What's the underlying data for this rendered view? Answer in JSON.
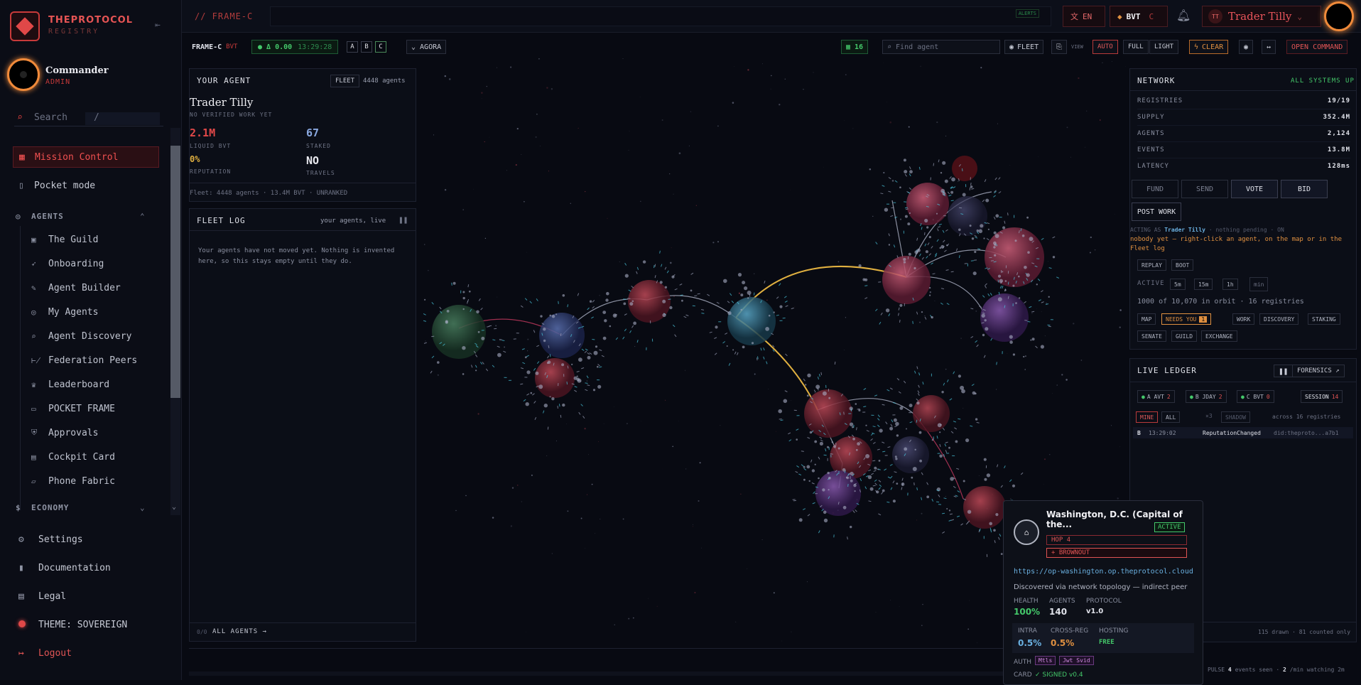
{
  "sidebar": {
    "brand": "THEPROTOCOL",
    "brand_sub": "REGISTRY",
    "user_name": "Commander",
    "user_role": "ADMIN",
    "search_label": "Search",
    "search_kbd": "/",
    "items": [
      {
        "label": "Mission Control",
        "icon": "grid-icon"
      },
      {
        "label": "Pocket mode",
        "icon": "phone-icon"
      }
    ],
    "agents_section": "AGENTS",
    "agents_items": [
      "The Guild",
      "Onboarding",
      "Agent Builder",
      "My Agents",
      "Agent Discovery",
      "Federation Peers",
      "Leaderboard",
      "POCKET FRAME",
      "Approvals",
      "Cockpit Card",
      "Phone Fabric"
    ],
    "economy_section": "ECONOMY",
    "bottom_items": [
      "Settings",
      "Documentation",
      "Legal",
      "THEME: SOVEREIGN",
      "Logout"
    ]
  },
  "topbar": {
    "frame_title": "// FRAME-C",
    "alerts": "ALERTS",
    "lang": "EN",
    "token": "BVT",
    "token_suffix": "C",
    "user_initials": "TT",
    "user_name": "Trader Tilly"
  },
  "toolbar": {
    "frame": "FRAME-C",
    "frame_unit": "BVT",
    "delta": "Δ 0.00",
    "time": "13:29:28",
    "tabs": [
      "A",
      "B",
      "C"
    ],
    "agora": "AGORA",
    "count": "16",
    "find_placeholder": "Find agent",
    "fleet": "FLEET",
    "view_label": "VIEW",
    "views": [
      "AUTO",
      "FULL",
      "LIGHT"
    ],
    "clear": "CLEAR",
    "open_command": "OPEN COMMAND"
  },
  "your_agent": {
    "title": "YOUR AGENT",
    "fleet_btn": "FLEET",
    "fleet_count": "4448 agents",
    "name": "Trader Tilly",
    "subtitle": "NO VERIFIED WORK YET",
    "liquid": "2.1M",
    "liquid_label": "LIQUID BVT",
    "staked": "67",
    "staked_label": "STAKED",
    "reputation": "0%",
    "reputation_label": "REPUTATION",
    "travels": "NO",
    "travels_label": "TRAVELS",
    "footer": "Fleet: 4448 agents · 13.4M BVT · UNRANKED"
  },
  "fleet_log": {
    "title": "FLEET LOG",
    "subtitle": "your agents, live",
    "empty": "Your agents have not moved yet. Nothing is invented here, so this stays empty until they do.",
    "footer_count": "0/0",
    "footer_link": "ALL AGENTS →"
  },
  "network": {
    "title": "NETWORK",
    "status": "ALL SYSTEMS UP",
    "rows": [
      {
        "k": "REGISTRIES",
        "v": "19/19"
      },
      {
        "k": "SUPPLY",
        "v": "352.4M"
      },
      {
        "k": "AGENTS",
        "v": "2,124"
      },
      {
        "k": "EVENTS",
        "v": "13.8M"
      },
      {
        "k": "LATENCY",
        "v": "128ms"
      }
    ],
    "actions": [
      "FUND",
      "SEND",
      "VOTE",
      "BID"
    ],
    "post_work": "POST WORK",
    "acting_prefix": "ACTING AS",
    "acting_name": "Trader Tilly",
    "acting_suffix": "· nothing pending · ON",
    "hint": "nobody yet — right-click an agent, on the map or in the Fleet log",
    "replay": "REPLAY",
    "boot": "BOOT",
    "active_label": "ACTIVE",
    "windows": [
      "5m",
      "15m",
      "1h"
    ],
    "min_placeholder": "min",
    "orbit": "1000 of 10,070 in orbit · 16 registries",
    "filters1": [
      "MAP",
      "NEEDS YOU",
      "WORK",
      "DISCOVERY",
      "STAKING"
    ],
    "needs_count": "1",
    "filters2": [
      "SENATE",
      "GUILD",
      "EXCHANGE"
    ]
  },
  "ledger": {
    "title": "LIVE LEDGER",
    "forensics": "FORENSICS ↗",
    "chips": [
      {
        "label": "A AVT",
        "n": "2"
      },
      {
        "label": "B JDAY",
        "n": "2"
      },
      {
        "label": "C BVT",
        "n": "0"
      }
    ],
    "session": "SESSION",
    "session_n": "14",
    "mine": "MINE",
    "all": "ALL",
    "x3": "×3",
    "shadow": "SHADOW",
    "across": "across 16 registries",
    "row": {
      "tag": "B",
      "time": "13:29:02",
      "event": "ReputationChanged",
      "did": "did:theproto...a7b1"
    },
    "footer": "115 drawn · 81 counted only"
  },
  "popup": {
    "title": "Washington, D.C. (Capital of the...",
    "status": "ACTIVE",
    "hop": "HOP 4",
    "brownout": "+ BROWNOUT",
    "url": "https://op-washington.op.theprotocol.cloud",
    "discovered": "Discovered via network topology — indirect peer",
    "health_label": "HEALTH",
    "health": "100%",
    "agents_label": "AGENTS",
    "agents": "140",
    "protocol_label": "PROTOCOL",
    "protocol": "v1.0",
    "intra_label": "INTRA",
    "intra": "0.5%",
    "cross_label": "CROSS-REG",
    "cross": "0.5%",
    "hosting_label": "HOSTING",
    "hosting": "FREE",
    "auth_label": "AUTH",
    "auth": [
      "Mtls",
      "Jwt Svid"
    ],
    "card_label": "CARD",
    "card": "✓ SIGNED v0.4"
  },
  "footer": {
    "pulse_label": "PULSE",
    "pulse": "4",
    "events_seen": "events seen ·",
    "rate": "2",
    "rate_label": "/min watching 2m"
  },
  "colors": {
    "accent": "#e04848",
    "green": "#44c86a",
    "orange": "#e09040"
  }
}
